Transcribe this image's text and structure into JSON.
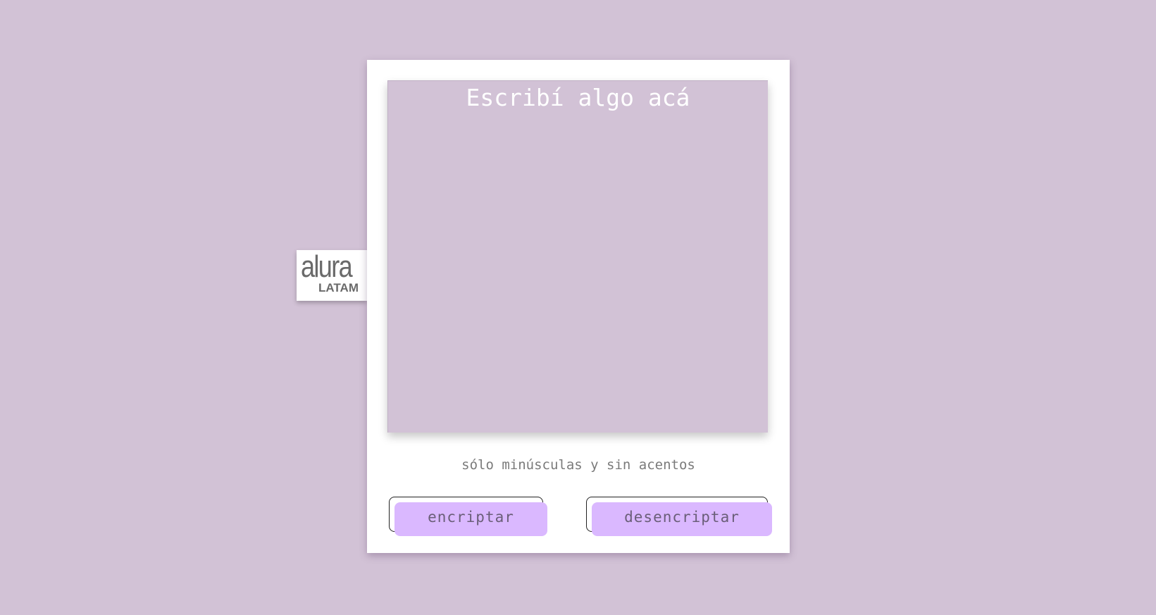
{
  "logo": {
    "brand": "alura",
    "region": "LATAM"
  },
  "input": {
    "placeholder": "Escribí algo acá",
    "value": ""
  },
  "hint": "sólo minúsculas y sin acentos",
  "buttons": {
    "encrypt_label": "encriptar",
    "decrypt_label": "desencriptar"
  },
  "colors": {
    "background": "#d2c2d6",
    "card": "#ffffff",
    "button": "#dab8ff",
    "button_text": "#6a5e78",
    "hint_text": "#7a7a7a"
  }
}
